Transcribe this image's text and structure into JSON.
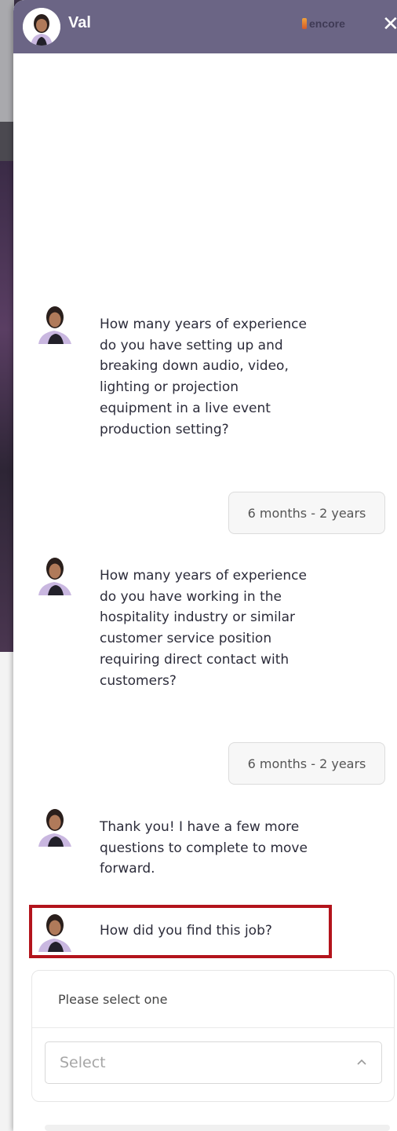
{
  "header": {
    "name": "Val",
    "brand": "encore",
    "close_icon": "close-icon"
  },
  "messages": [
    {
      "from": "bot",
      "text": "How many years of experience do you have setting up and breaking down audio, video, lighting or projection equipment in a live event production setting?"
    },
    {
      "from": "user",
      "text": "6 months - 2 years"
    },
    {
      "from": "bot",
      "text": "How many years of experience do you have working in the hospitality industry or similar customer service position requiring direct contact with customers?"
    },
    {
      "from": "user",
      "text": "6 months - 2 years"
    },
    {
      "from": "bot",
      "text": "Thank you! I have a few more questions to complete to move forward."
    },
    {
      "from": "bot",
      "text": "How did you find this job?"
    }
  ],
  "select_card": {
    "prompt": "Please select one",
    "placeholder": "Select",
    "chevron_icon": "chevron-up-icon"
  },
  "colors": {
    "header_bg": "#6b6585",
    "highlight": "#b3141c"
  }
}
